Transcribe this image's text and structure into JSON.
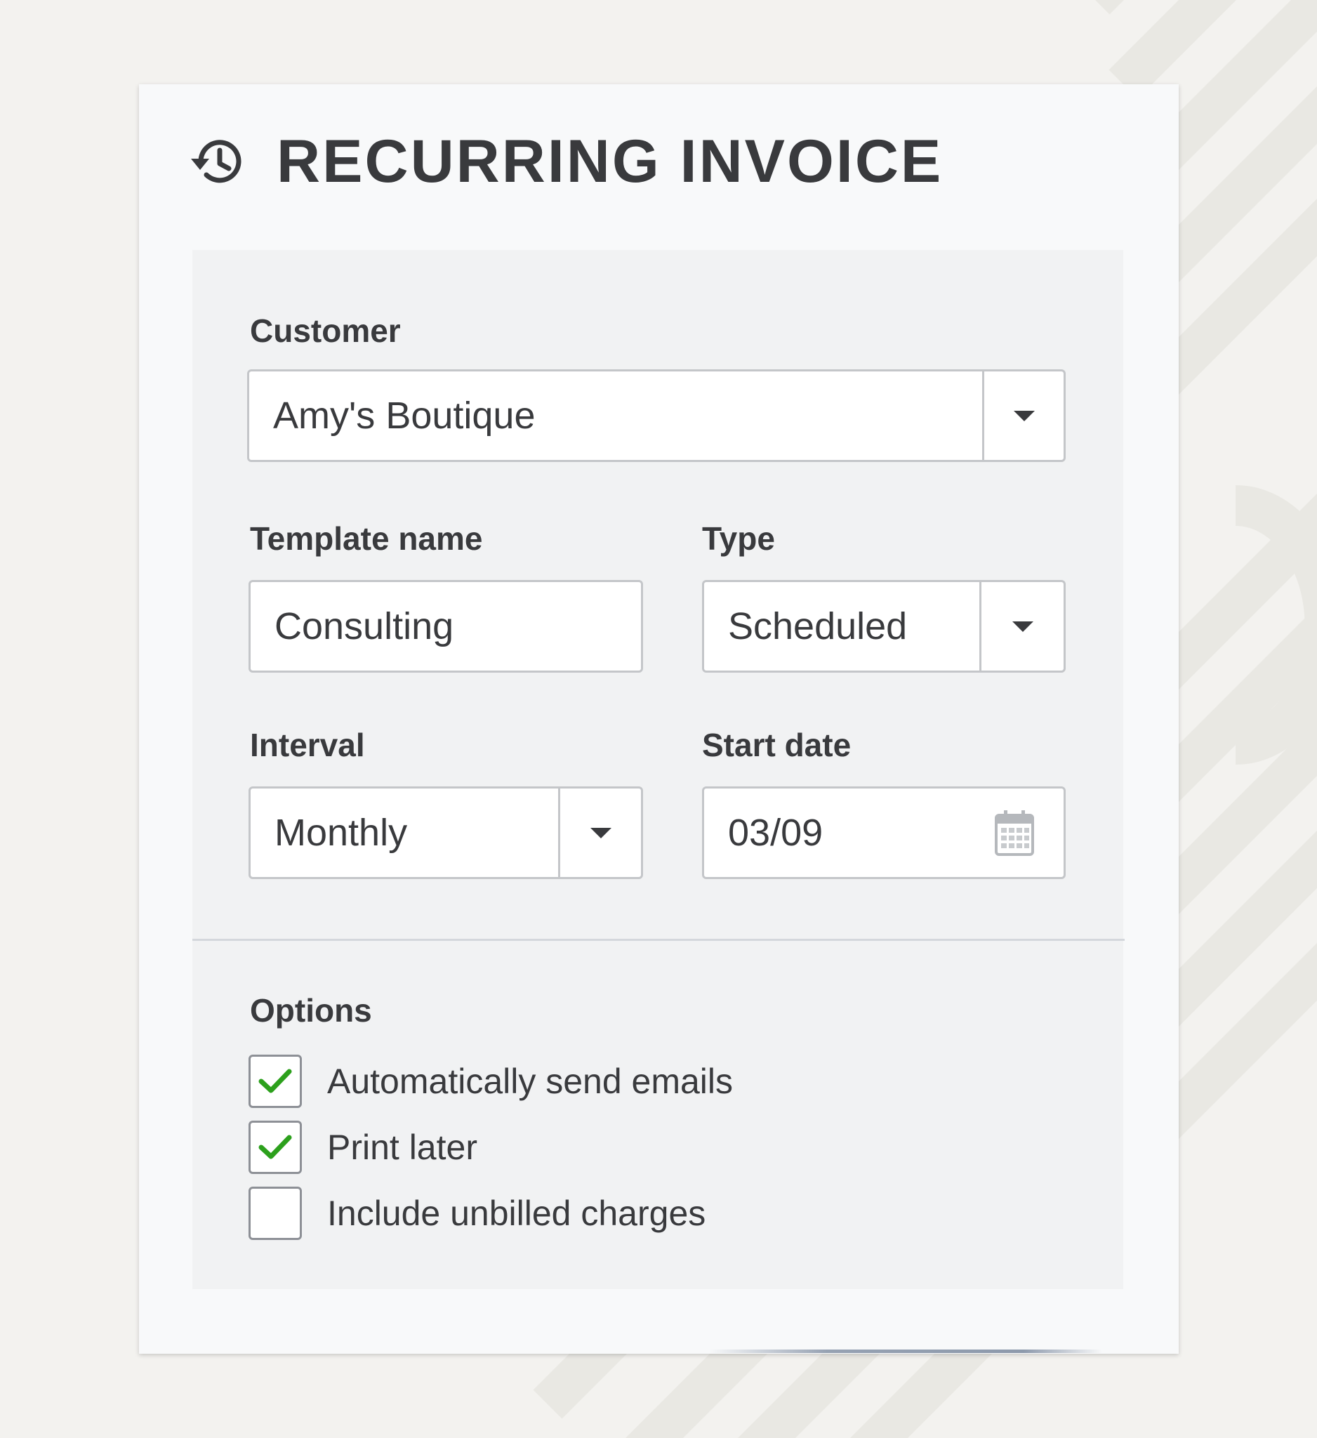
{
  "dialog": {
    "title": "RECURRING INVOICE",
    "icon": "history-icon"
  },
  "form": {
    "customer": {
      "label": "Customer",
      "value": "Amy's Boutique"
    },
    "template_name": {
      "label": "Template name",
      "value": "Consulting"
    },
    "type": {
      "label": "Type",
      "value": "Scheduled"
    },
    "interval": {
      "label": "Interval",
      "value": "Monthly"
    },
    "start_date": {
      "label": "Start date",
      "value": "03/09",
      "icon": "calendar-icon"
    }
  },
  "options": {
    "label": "Options",
    "items": [
      {
        "label": "Automatically send emails",
        "checked": true
      },
      {
        "label": "Print later",
        "checked": true
      },
      {
        "label": "Include unbilled charges",
        "checked": false
      }
    ]
  },
  "colors": {
    "check": "#2ca01c",
    "text": "#393a3d",
    "border": "#c4c6c9",
    "background": "#f3f2ef"
  }
}
